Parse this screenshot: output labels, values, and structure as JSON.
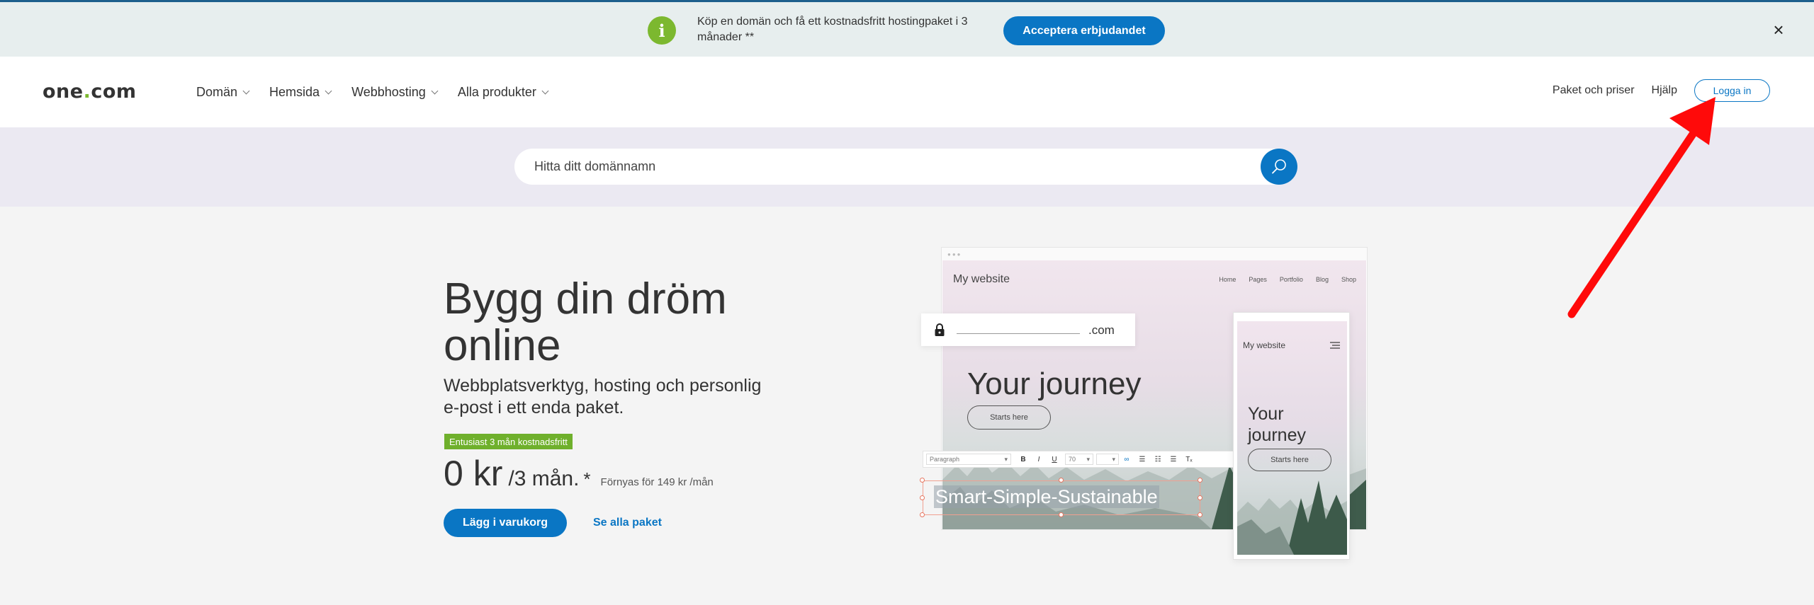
{
  "promo": {
    "icon": "info-icon",
    "icon_glyph": "i",
    "text": "Köp en domän och få ett kostnadsfritt hostingpaket i 3 månader **",
    "cta": "Acceptera erbjudandet",
    "close": "×"
  },
  "header": {
    "logo_main": "one",
    "logo_dot": ".",
    "logo_tld": "com",
    "nav": [
      {
        "label": "Domän"
      },
      {
        "label": "Hemsida"
      },
      {
        "label": "Webbhosting"
      },
      {
        "label": "Alla produkter"
      }
    ],
    "pricing_link": "Paket och priser",
    "help_link": "Hjälp",
    "login_button": "Logga in"
  },
  "search": {
    "placeholder": "Hitta ditt domännamn"
  },
  "hero": {
    "title_line1": "Bygg din dröm",
    "title_line2": "online",
    "subtitle": "Webbplatsverktyg, hosting och personlig e-post i ett enda paket.",
    "badge": "Entusiast 3 mån kostnadsfritt",
    "price_main": "0 kr",
    "price_period": "/3 mån.",
    "price_star": "*",
    "price_renewal": "Förnyas för 149 kr /mån",
    "cart_button": "Lägg i varukorg",
    "all_packages_link": "Se alla paket"
  },
  "illustration": {
    "site_name": "My website",
    "site_nav": [
      "Home",
      "Pages",
      "Portfolio",
      "Blog",
      "Shop"
    ],
    "headline": "Your journey",
    "cta": "Starts here",
    "domain_tld": ".com",
    "toolbar_style": "Paragraph",
    "toolbar_size": "70",
    "toolbar_buttons": [
      "B",
      "I",
      "U"
    ],
    "editable_text": "Smart-Simple-Sustainable",
    "phone_site_name": "My website",
    "phone_headline_line1": "Your",
    "phone_headline_line2": "journey",
    "phone_cta": "Starts here"
  },
  "colors": {
    "accent": "#0a76c4",
    "green": "#7cb82f",
    "annotation": "#ff0000"
  }
}
